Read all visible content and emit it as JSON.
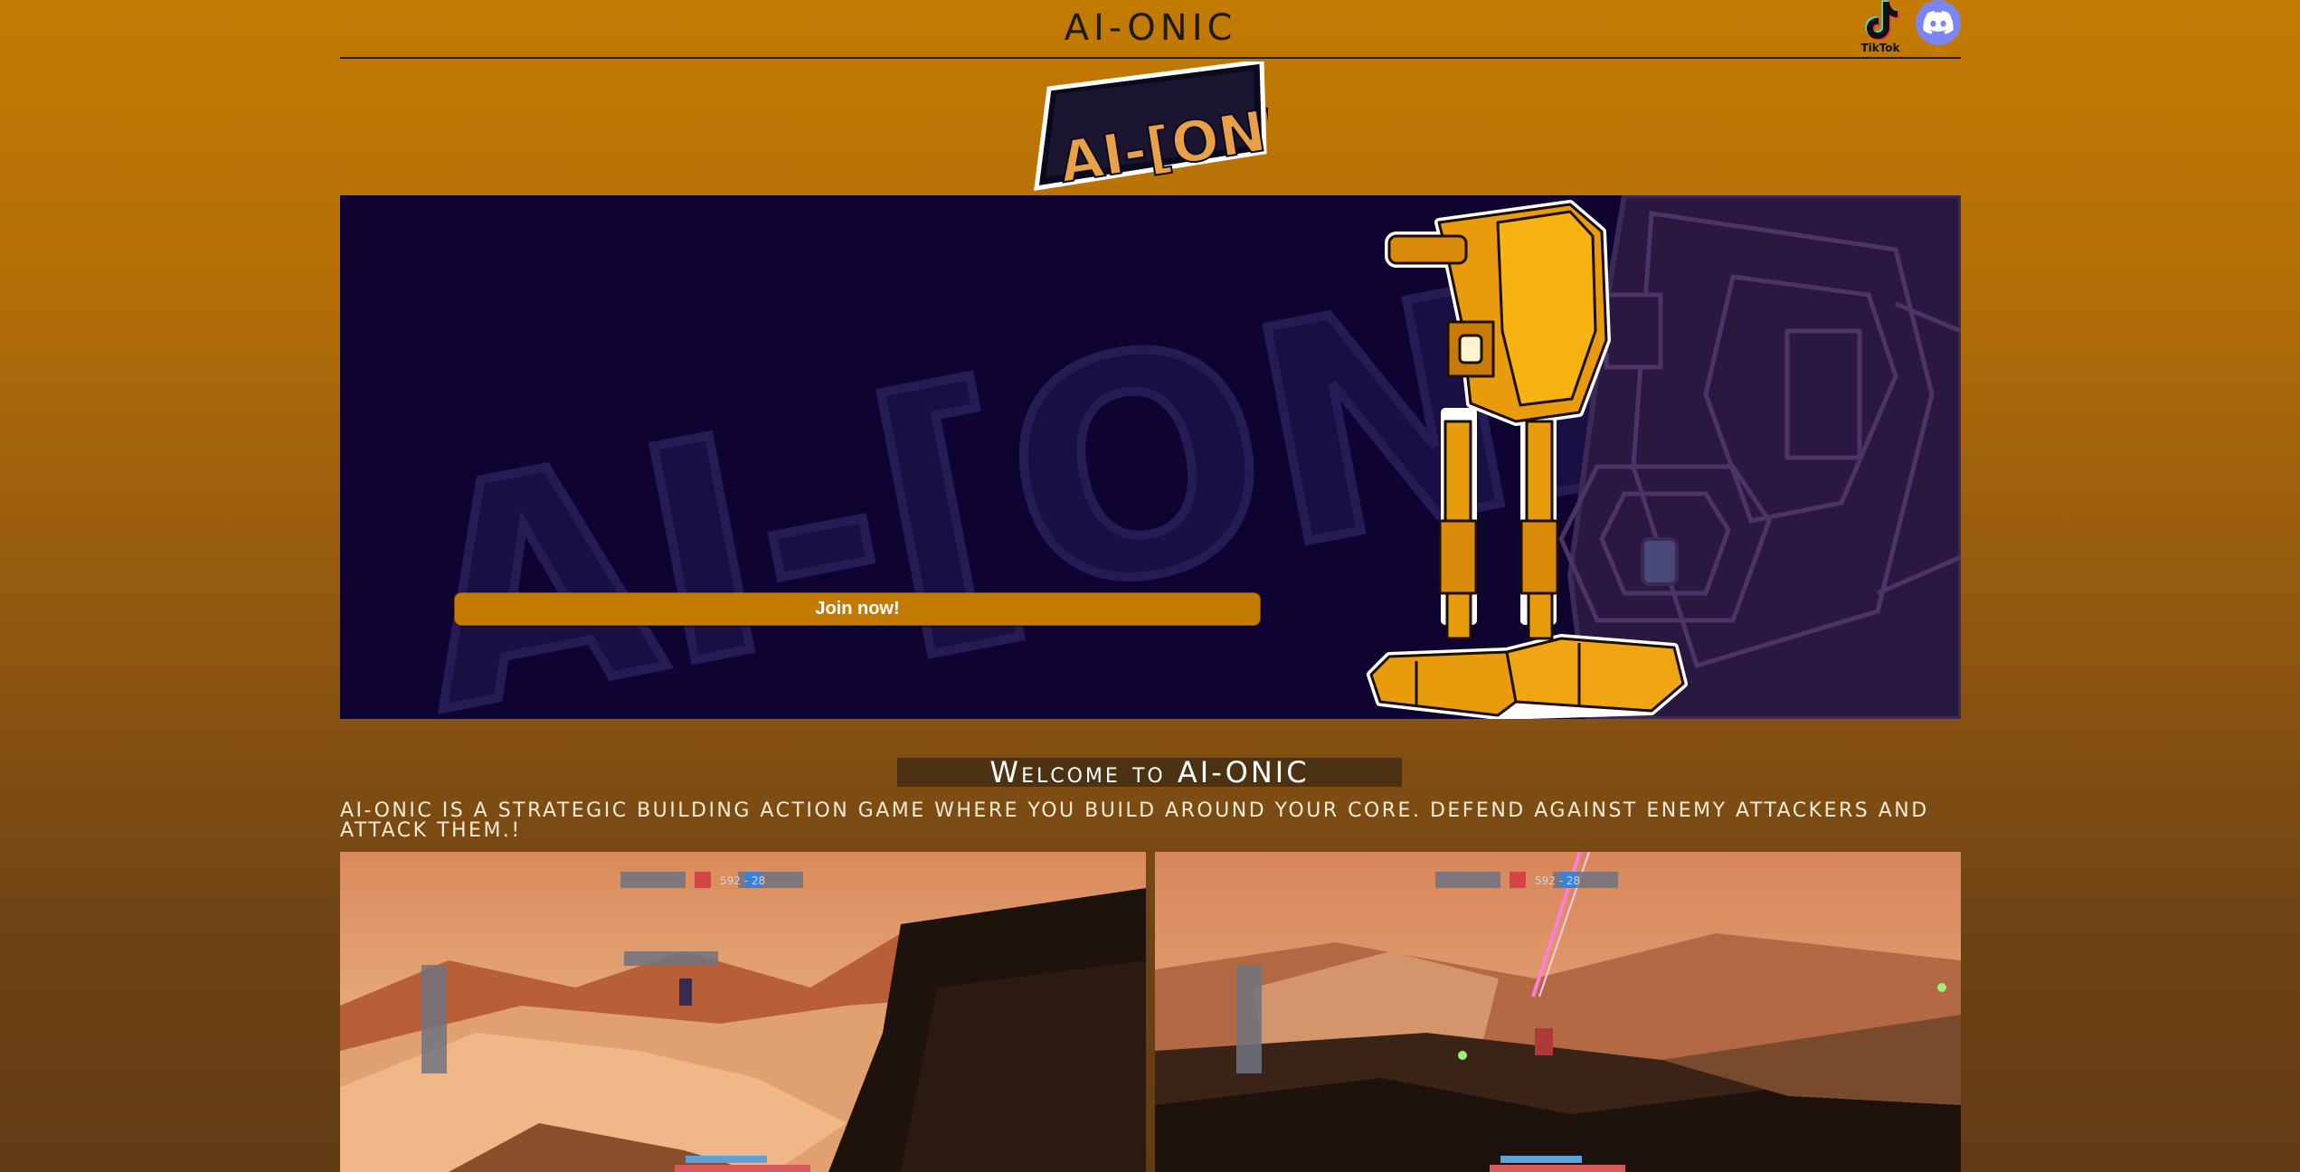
{
  "header": {
    "title": "AI-ONIC",
    "tiktok_label": "TikTok",
    "tiktok_icon": "tiktok-icon",
    "discord_icon": "discord-icon"
  },
  "logo": {
    "text": "AI-[ONIC]"
  },
  "hero": {
    "background_text": "AI-[ONIC]",
    "join_label": "Join now!"
  },
  "welcome": {
    "heading": "Welcome to AI-ONIC",
    "description": "AI-onic is a strategic building action game where you build around your core. Defend against enemy attackers and attack them.!"
  },
  "screenshots": [
    {
      "name": "gameplay-screenshot-1",
      "hud_score": "592 - 28"
    },
    {
      "name": "gameplay-screenshot-2",
      "hud_score": "592 - 28"
    }
  ],
  "colors": {
    "accent": "#c47b03",
    "hero_bg": "#0f0332",
    "discord": "#7b86f2"
  }
}
